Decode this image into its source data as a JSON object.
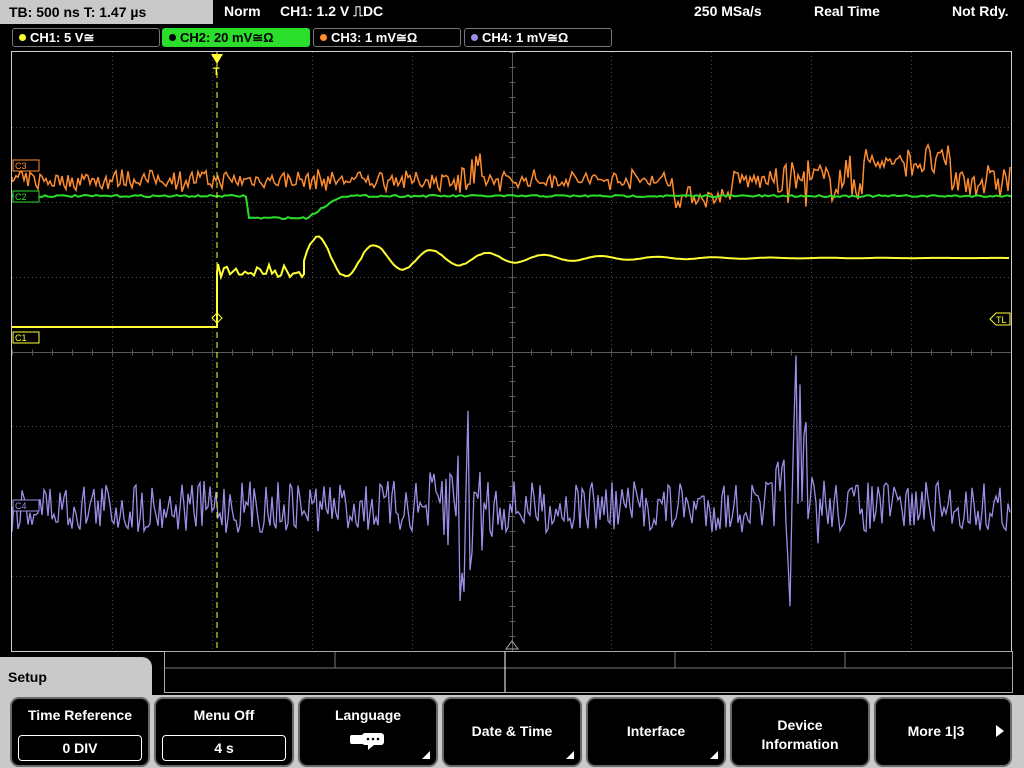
{
  "status_bar": {
    "timebase_label": "TB: 500 ns   T: 1.47 µs",
    "trigger_mode": "Norm",
    "trigger_info": "CH1: 1.2 V ⎍DC",
    "sample_rate": "250 MSa/s",
    "acq_mode": "Real Time",
    "trigger_status": "Not Rdy."
  },
  "channels": [
    {
      "label": "CH1: 5 V≅",
      "color": "#ffff33"
    },
    {
      "label": "CH2: 20 mV≅Ω",
      "color": "#2bde2b",
      "active": true
    },
    {
      "label": "CH3: 1 mV≅Ω",
      "color": "#ff8c2e"
    },
    {
      "label": "CH4: 1 mV≅Ω",
      "color": "#9a8fe8"
    }
  ],
  "markers": {
    "ch3_marker": "C3",
    "ch2_marker": "C2",
    "ch1_marker": "C1",
    "ch4_marker": "C4",
    "trigger_level": "TL",
    "trigger_pos": "T"
  },
  "menu": {
    "title": "Setup",
    "softkeys": [
      {
        "label": "Time Reference",
        "value": "0 DIV"
      },
      {
        "label": "Menu Off",
        "value": "4 s"
      },
      {
        "label": "Language",
        "icon": "speech-bubble-icon"
      },
      {
        "label": "Date & Time"
      },
      {
        "label": "Interface"
      },
      {
        "label_line1": "Device",
        "label_line2": "Information"
      },
      {
        "label": "More 1|3"
      }
    ]
  }
}
